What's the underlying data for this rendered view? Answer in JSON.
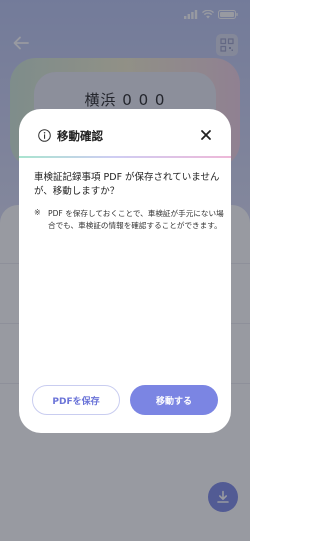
{
  "background": {
    "plate_text": "横浜 0 0 0",
    "icons": {
      "back": "back-arrow-icon",
      "qr": "qr-code-icon",
      "download": "download-icon"
    }
  },
  "dialog": {
    "title": "移動確認",
    "message": "車検証記録事項 PDF が保存されていませんが、移動しますか？",
    "note_mark": "※",
    "note": "PDF を保存しておくことで、車検証が手元にない場合でも、車検証の情報を確認することができます。",
    "save_button": "PDFを保存",
    "move_button": "移動する"
  },
  "colors": {
    "accent": "#7b85e3",
    "accent_text": "#6b74d8",
    "overlay": "rgba(40,44,58,0.48)"
  }
}
